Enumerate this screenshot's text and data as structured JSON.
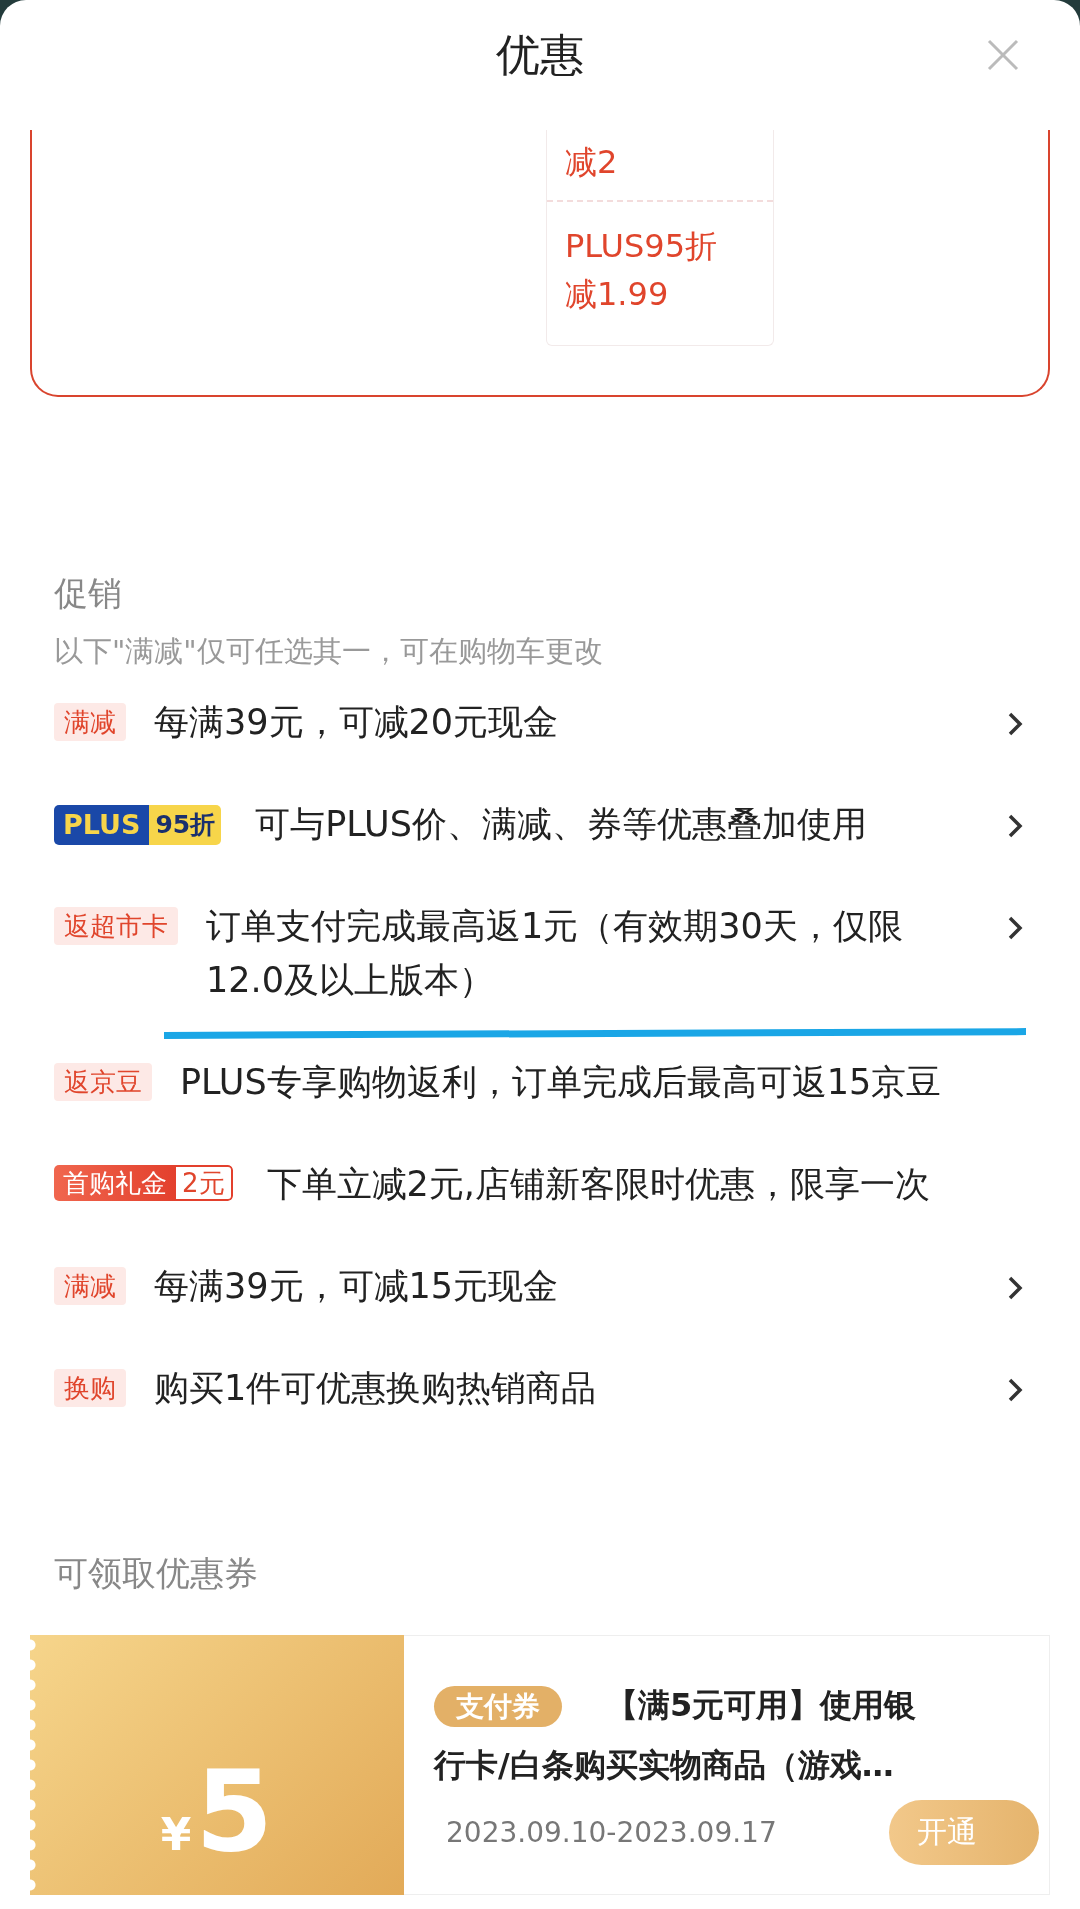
{
  "header": {
    "title": "优惠"
  },
  "summary_card": {
    "cells": [
      {
        "lines": [
          "减2"
        ]
      },
      {
        "lines": [
          "PLUS95折",
          "减1.99"
        ]
      }
    ]
  },
  "promotions": {
    "title": "促销",
    "note": "以下\"满减\"仅可任选其一，可在购物车更改",
    "rows": [
      {
        "tag": {
          "kind": "plain",
          "parts": [
            "满减"
          ]
        },
        "text": "每满39元，可减20元现金",
        "has_arrow": true,
        "underlined": false
      },
      {
        "tag": {
          "kind": "plus",
          "parts": [
            "PLUS",
            "95折"
          ]
        },
        "text": "可与PLUS价、满减、券等优惠叠加使用",
        "has_arrow": true,
        "underlined": false
      },
      {
        "tag": {
          "kind": "plain",
          "parts": [
            "返超市卡"
          ]
        },
        "text": "订单支付完成最高返1元（有效期30天，仅限12.0及以上版本）",
        "has_arrow": true,
        "underlined": true
      },
      {
        "tag": {
          "kind": "plain",
          "parts": [
            "返京豆"
          ]
        },
        "text": "PLUS专享购物返利，订单完成后最高可返15京豆",
        "has_arrow": false,
        "underlined": false
      },
      {
        "tag": {
          "kind": "gift",
          "parts": [
            "首购礼金",
            "2元"
          ]
        },
        "text": "下单立减2元,店铺新客限时优惠，限享一次",
        "has_arrow": false,
        "underlined": false
      },
      {
        "tag": {
          "kind": "plain",
          "parts": [
            "满减"
          ]
        },
        "text": "每满39元，可减15元现金",
        "has_arrow": true,
        "underlined": false
      },
      {
        "tag": {
          "kind": "plain",
          "parts": [
            "换购"
          ]
        },
        "text": "购买1件可优惠换购热销商品",
        "has_arrow": true,
        "underlined": false
      }
    ]
  },
  "coupons": {
    "title": "可领取优惠券",
    "items": [
      {
        "currency": "¥",
        "amount": "5",
        "tag": "支付券",
        "title": "【满5元可用】使用银行卡/白条购买实物商品（游戏…",
        "date": "2023.09.10-2023.09.17",
        "button": "开通"
      }
    ]
  }
}
